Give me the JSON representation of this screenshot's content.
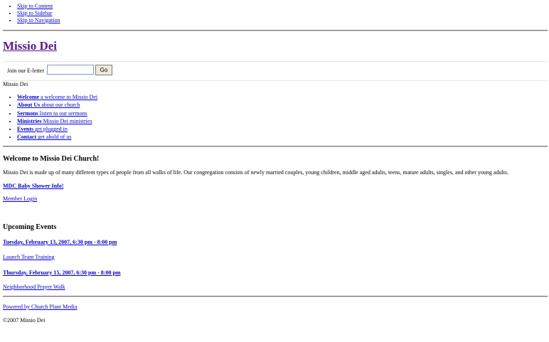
{
  "skip_links": [
    "Skip to Content",
    "Skip to Sidebar",
    "Skip to Navigation"
  ],
  "site": {
    "title": "Missio Dei"
  },
  "signup": {
    "label": "Join our E-letter",
    "input_value": "",
    "button": "Go"
  },
  "nav": {
    "heading": "Missio Dei",
    "items": [
      {
        "title": "Welcome",
        "desc": "a welcome to Missio Dei"
      },
      {
        "title": "About Us",
        "desc": "about our church"
      },
      {
        "title": "Sermons",
        "desc": "listen to our sermons"
      },
      {
        "title": "Ministries",
        "desc": "Missio Dei ministries"
      },
      {
        "title": "Events",
        "desc": "get plugged in"
      },
      {
        "title": "Contact",
        "desc": "get ahold of us"
      }
    ]
  },
  "content": {
    "title": "Welcome to Missio Dei Church!",
    "intro": "Missio Dei is made up of many different types of people from all walks of life. Our congregation consists of newly married couples, young children, middle aged adults, teens, mature adults, singles, and other young adults.",
    "baby_link": "MDC Baby Shower Info!",
    "login_link": "Member Login"
  },
  "events": {
    "title": "Upcoming Events",
    "items": [
      {
        "date": "Tuesday, February 13, 2007, 6:30 pm - 8:00 pm",
        "name": "Launch Team Training"
      },
      {
        "date": "Thursday, February 15, 2007, 6:30 pm - 8:00 pm",
        "name": "Neighborhood Prayer Walk"
      }
    ]
  },
  "footer": {
    "powered": "Powered by Church Plant Media",
    "copyright": "©2007 Missio Dei"
  }
}
